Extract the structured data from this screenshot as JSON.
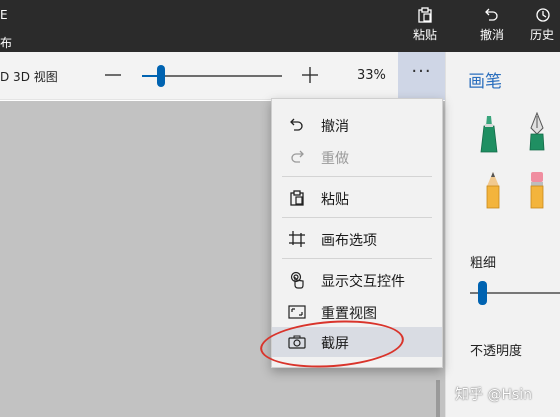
{
  "topbar": {
    "left_line1": "E",
    "left_line2": "布",
    "paste_label": "粘贴",
    "undo_label": "撤消",
    "history_label": "历史"
  },
  "subbar": {
    "view3d_label": "D 3D 视图",
    "zoom_percent": "33%",
    "zoom_slider_value": 0.15,
    "more_label": "···"
  },
  "menu": {
    "items": [
      {
        "label": "撤消",
        "icon": "undo-icon",
        "enabled": true
      },
      {
        "label": "重做",
        "icon": "redo-icon",
        "enabled": false
      },
      {
        "label": "粘贴",
        "icon": "paste-icon",
        "enabled": true
      },
      {
        "label": "画布选项",
        "icon": "crop-icon",
        "enabled": true
      },
      {
        "label": "显示交互控件",
        "icon": "touch-icon",
        "enabled": true
      },
      {
        "label": "重置视图",
        "icon": "reset-view-icon",
        "enabled": true
      },
      {
        "label": "截屏",
        "icon": "camera-icon",
        "enabled": true,
        "highlighted": true
      }
    ]
  },
  "right_panel": {
    "title": "画笔",
    "thickness_label": "粗细",
    "thickness_value": 0.1,
    "opacity_label": "不透明度",
    "watermark": "知乎 @Hsin"
  },
  "colors": {
    "accent": "#0063b1",
    "title_blue": "#2a6ebd",
    "annotation_red": "#d9342b"
  }
}
